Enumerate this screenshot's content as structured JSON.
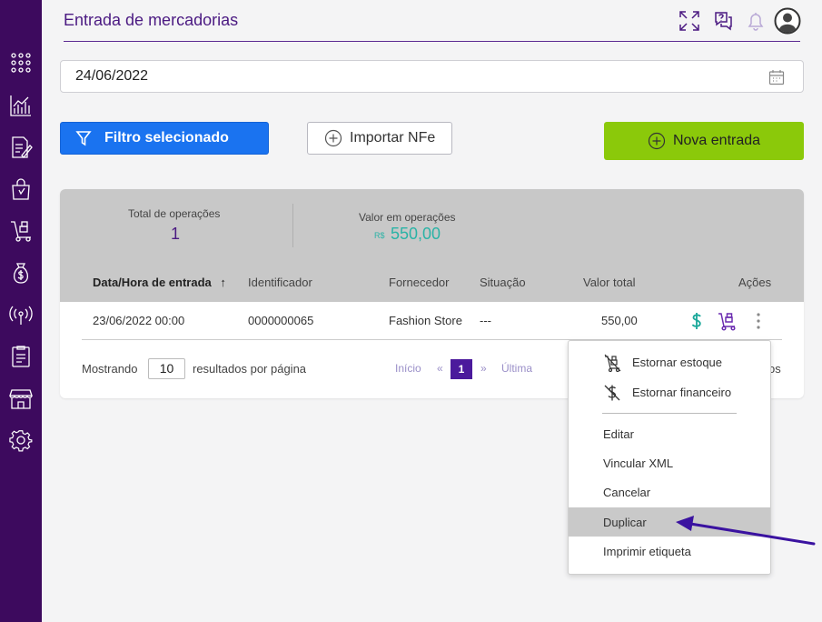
{
  "page": {
    "title": "Entrada de mercadorias"
  },
  "sidebar": {
    "items": [
      {
        "icon": "apps-grid-icon"
      },
      {
        "icon": "chart-icon"
      },
      {
        "icon": "document-edit-icon"
      },
      {
        "icon": "shopping-bag-icon"
      },
      {
        "icon": "hand-truck-icon"
      },
      {
        "icon": "money-bag-icon"
      },
      {
        "icon": "broadcast-icon"
      },
      {
        "icon": "report-icon"
      },
      {
        "icon": "store-icon"
      },
      {
        "icon": "gear-icon"
      }
    ]
  },
  "header": {
    "icons": [
      "fullscreen-icon",
      "help-chat-icon",
      "bell-icon",
      "user-avatar-icon"
    ]
  },
  "date_filter": {
    "value": "24/06/2022"
  },
  "toolbar": {
    "filter_label": "Filtro selecionado",
    "import_label": "Importar NFe",
    "new_label": "Nova entrada"
  },
  "stats": {
    "total_label": "Total de operações",
    "total_value": "1",
    "value_label": "Valor em operações",
    "currency": "R$",
    "value_value": "550,00"
  },
  "table": {
    "columns": [
      "Data/Hora de entrada",
      "Identificador",
      "Fornecedor",
      "Situação",
      "Valor total",
      "Ações"
    ],
    "rows": [
      {
        "date": "23/06/2022 00:00",
        "id": "0000000065",
        "supplier": "Fashion Store",
        "status": "---",
        "total": "550,00"
      }
    ]
  },
  "pagination": {
    "showing_label": "Mostrando",
    "per_page": "10",
    "per_page_label": "resultados por página",
    "first": "Início",
    "prev": "«",
    "current": "1",
    "next": "»",
    "last": "Última",
    "trailing": "os"
  },
  "menu": {
    "items": [
      {
        "label": "Estornar estoque",
        "icon": "no-stock-icon"
      },
      {
        "label": "Estornar financeiro",
        "icon": "no-money-icon"
      },
      {
        "label": "Editar"
      },
      {
        "label": "Vincular XML"
      },
      {
        "label": "Cancelar"
      },
      {
        "label": "Duplicar"
      },
      {
        "label": "Imprimir etiqueta"
      }
    ]
  },
  "colors": {
    "sidebar": "#3d0a5e",
    "accent_purple": "#4b1a82",
    "filter_blue": "#1a73f0",
    "new_green": "#8bc90a",
    "value_teal": "#2ab3a6"
  }
}
